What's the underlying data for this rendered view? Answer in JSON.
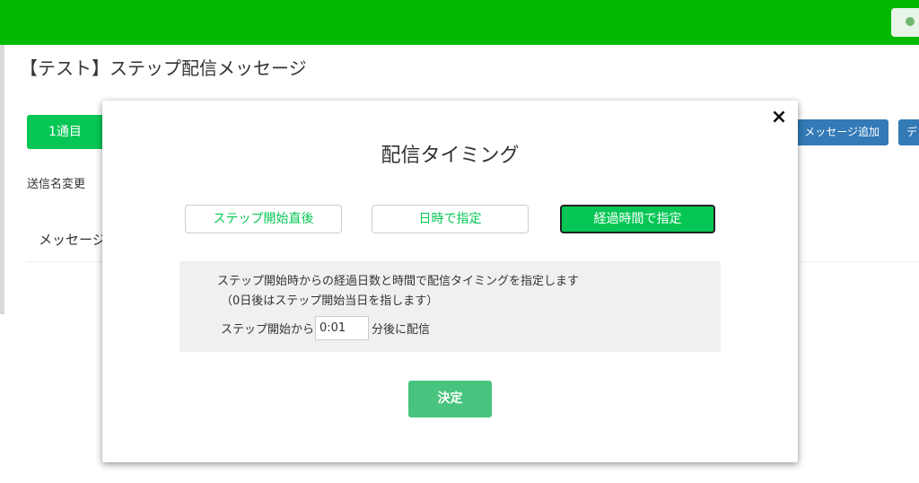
{
  "page": {
    "title": "【テスト】ステップ配信メッセージ",
    "tab_label": "1通目",
    "sender_change_label": "送信名変更",
    "message_label": "メッセージ",
    "add_message_label": "メッセージ追加",
    "next_button_label": "デ"
  },
  "modal": {
    "title": "配信タイミング",
    "close_icon": "×",
    "options": [
      {
        "label": "ステップ開始直後",
        "active": false
      },
      {
        "label": "日時で指定",
        "active": false
      },
      {
        "label": "経過時間で指定",
        "active": true
      }
    ],
    "description_line1": "ステップ開始時からの経過日数と時間で配信タイミングを指定します",
    "description_line2": "（0日後はステップ開始当日を指します）",
    "delay_prefix": "ステップ開始から",
    "delay_value": "0:01",
    "delay_suffix": "分後に配信",
    "submit_label": "決定"
  },
  "colors": {
    "header_green": "#00b900",
    "line_green": "#06c755",
    "submit_green": "#48c47e",
    "button_blue": "#337ab7"
  }
}
